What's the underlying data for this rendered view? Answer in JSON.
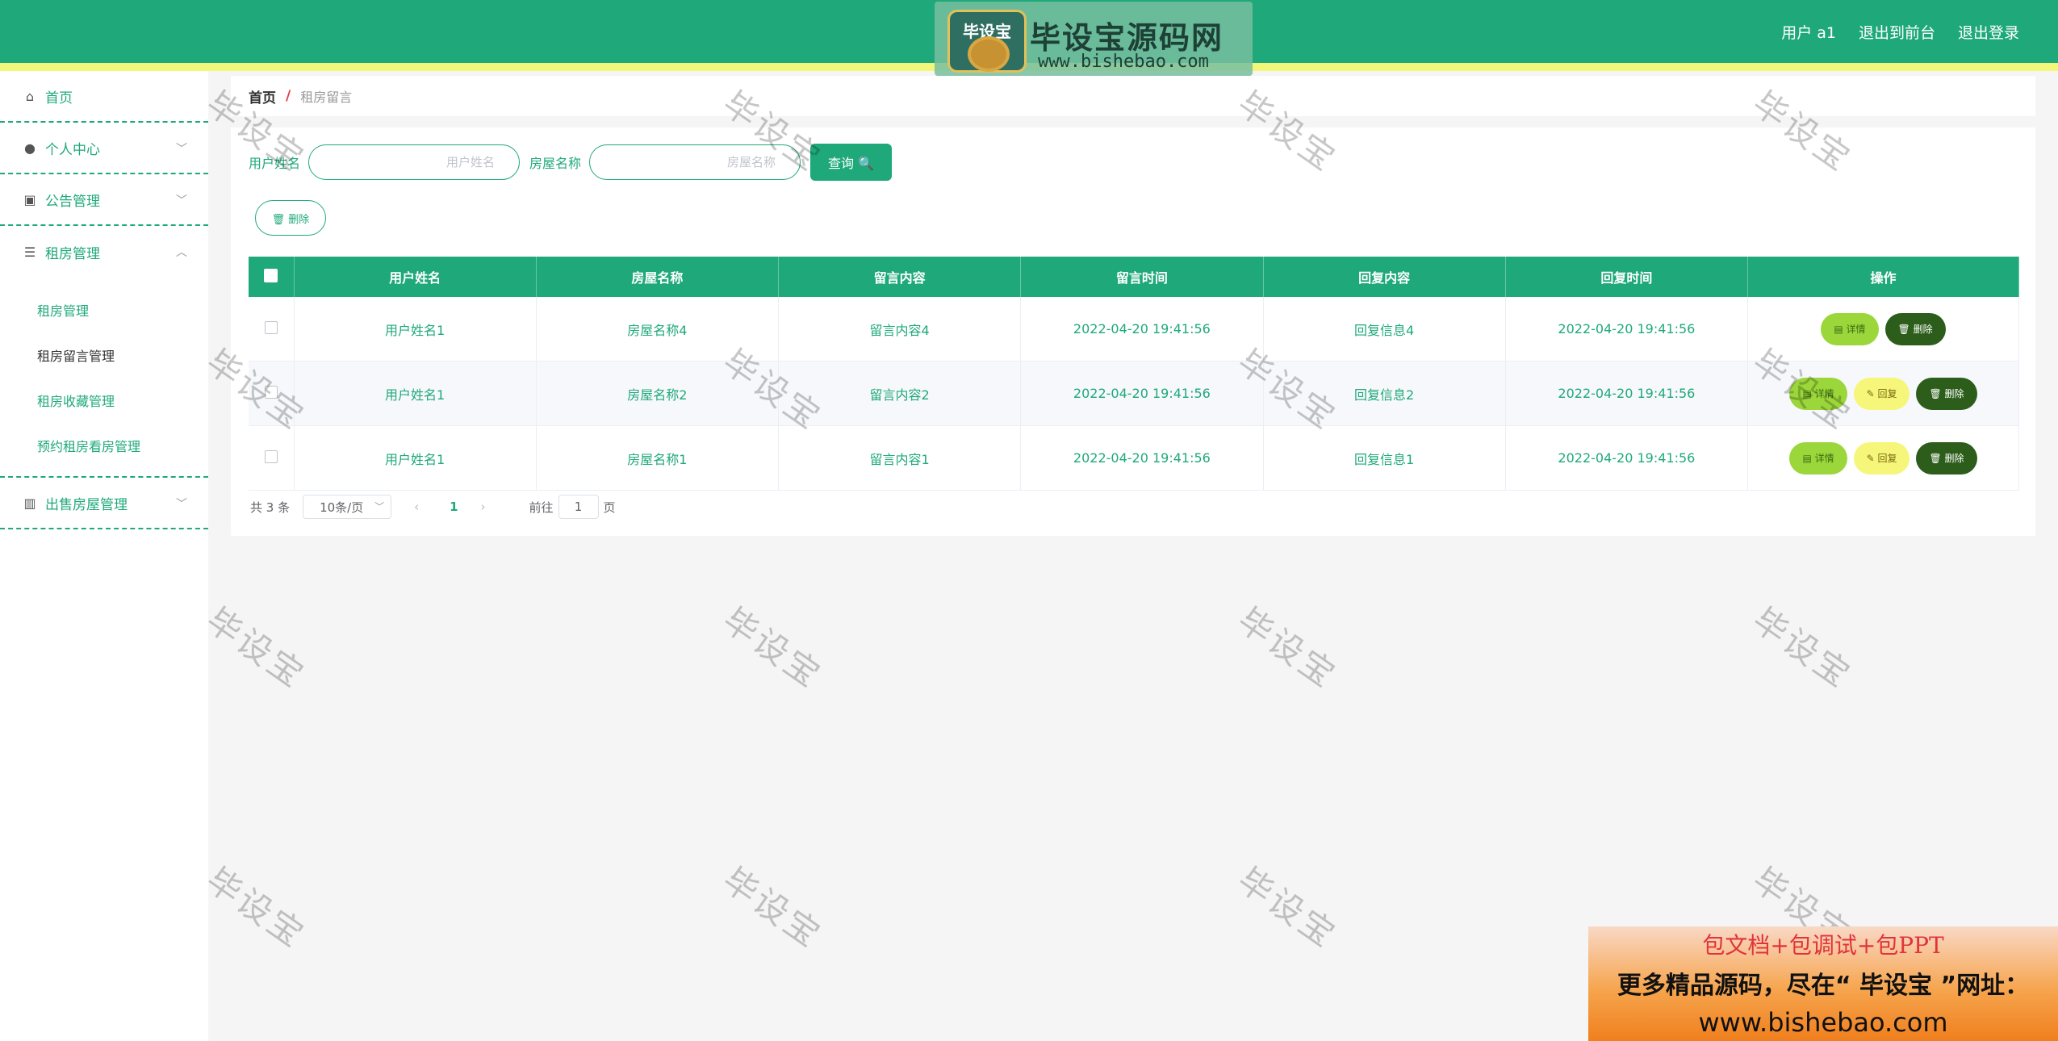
{
  "header": {
    "brand_title": "毕设宝源码网",
    "brand_url": "www.bishebao.com",
    "logo_text": "毕设宝",
    "user_label": "用户 a1",
    "back_front_label": "退出到前台",
    "logout_label": "退出登录"
  },
  "sidebar": {
    "items": [
      {
        "label": "首页",
        "icon": "home-icon"
      },
      {
        "label": "个人中心",
        "icon": "user-icon"
      },
      {
        "label": "公告管理",
        "icon": "clipboard-icon"
      },
      {
        "label": "租房管理",
        "icon": "list-icon"
      },
      {
        "label": "出售房屋管理",
        "icon": "bar-chart-icon"
      }
    ],
    "submenu": [
      {
        "label": "租房管理"
      },
      {
        "label": "租房留言管理"
      },
      {
        "label": "租房收藏管理"
      },
      {
        "label": "预约租房看房管理"
      }
    ]
  },
  "breadcrumb": {
    "home": "首页",
    "separator": "/",
    "current": "租房留言"
  },
  "search": {
    "user_label": "用户姓名",
    "user_placeholder": "用户姓名",
    "house_label": "房屋名称",
    "house_placeholder": "房屋名称",
    "query_label": "查询 🔍"
  },
  "toolbar": {
    "delete_label": "🗑 删除"
  },
  "table": {
    "headers": [
      "用户姓名",
      "房屋名称",
      "留言内容",
      "留言时间",
      "回复内容",
      "回复时间",
      "操作"
    ],
    "rows": [
      {
        "user": "用户姓名1",
        "house": "房屋名称4",
        "message": "留言内容4",
        "msg_time": "2022-04-20 19:41:56",
        "reply": "回复信息4",
        "reply_time": "2022-04-20 19:41:56"
      },
      {
        "user": "用户姓名1",
        "house": "房屋名称2",
        "message": "留言内容2",
        "msg_time": "2022-04-20 19:41:56",
        "reply": "回复信息2",
        "reply_time": "2022-04-20 19:41:56"
      },
      {
        "user": "用户姓名1",
        "house": "房屋名称1",
        "message": "留言内容1",
        "msg_time": "2022-04-20 19:41:56",
        "reply": "回复信息1",
        "reply_time": "2022-04-20 19:41:56"
      }
    ],
    "ops": {
      "detail": "▤ 详情",
      "reply": "✎ 回复",
      "delete": "🗑 删除"
    }
  },
  "pager": {
    "total": "共 3 条",
    "page_size": "10条/页",
    "current_page": "1",
    "goto_prefix": "前往",
    "goto_value": "1",
    "goto_suffix": "页"
  },
  "watermark": "毕设宝",
  "promo": {
    "line1": "包文档+包调试+包PPT",
    "line2": "更多精品源码，尽在“ 毕设宝 ”网址：",
    "line3": "www.bishebao.com"
  },
  "colors": {
    "primary": "#1fa97a",
    "stripe": "#f2f77a",
    "detail_btn": "#9bd63a",
    "reply_btn": "#f6f67a",
    "delete_btn": "#2c5d1b"
  }
}
